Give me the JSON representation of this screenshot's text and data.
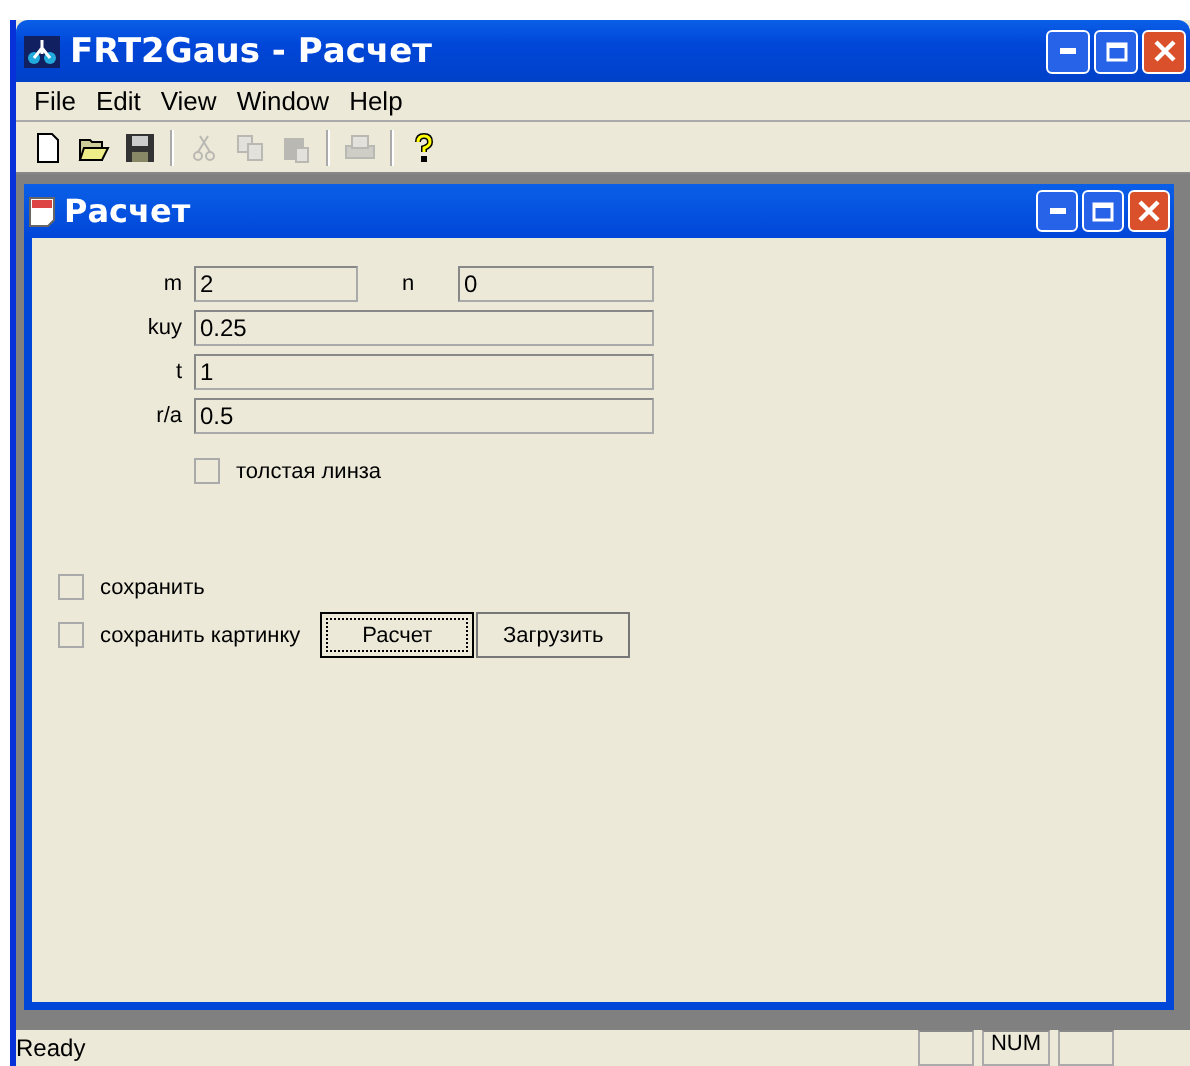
{
  "window": {
    "title": "FRT2Gaus - Расчет"
  },
  "menu": [
    "File",
    "Edit",
    "View",
    "Window",
    "Help"
  ],
  "toolbar": [
    {
      "kind": "new",
      "disabled": false
    },
    {
      "kind": "open",
      "disabled": false
    },
    {
      "kind": "save",
      "disabled": false
    },
    {
      "kind": "sep"
    },
    {
      "kind": "cut",
      "disabled": true
    },
    {
      "kind": "copy",
      "disabled": true
    },
    {
      "kind": "paste",
      "disabled": true
    },
    {
      "kind": "sep"
    },
    {
      "kind": "print",
      "disabled": true
    },
    {
      "kind": "sep"
    },
    {
      "kind": "help",
      "disabled": false
    }
  ],
  "child": {
    "title": "Расчет",
    "fields": [
      {
        "label": "m",
        "value": "2"
      },
      {
        "label": "n",
        "value": "0"
      },
      {
        "label": "kuy",
        "value": "0.25"
      },
      {
        "label": "t",
        "value": "1"
      },
      {
        "label": "r/a",
        "value": "0.5"
      }
    ],
    "thick_lens": {
      "label": "толстая линза",
      "checked": false
    },
    "save": {
      "label": "сохранить",
      "checked": false
    },
    "save_picture": {
      "label": "сохранить картинку",
      "checked": false
    },
    "buttons": [
      {
        "label": "Расчет",
        "focused": true
      },
      {
        "label": "Загрузить",
        "focused": false
      }
    ]
  },
  "status_bar": {
    "text": "Ready",
    "num_indicator": "NUM"
  }
}
